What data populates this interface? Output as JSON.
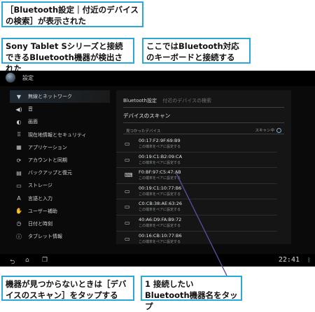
{
  "callouts": {
    "scan_screen": "［Bluetooth設定｜付近のデバイスの検索］が表示された",
    "detected": "Sony Tablet Sシリーズと接続できるBluetooth機器が検出された",
    "keyboard": "ここではBluetooth対応のキーボードと接続する",
    "not_found": "機器が見つからないときは［デバイスのスキャン］をタップする",
    "step_number": "1",
    "step_text": "接続したいBluetooth機器名をタップ"
  },
  "app": {
    "title": "設定"
  },
  "nav": [
    {
      "icon": "▼",
      "label": "無線とネットワーク"
    },
    {
      "icon": "◀)",
      "label": "音"
    },
    {
      "icon": "◐",
      "label": "画面"
    },
    {
      "icon": "⠿",
      "label": "現在地情報とセキュリティ"
    },
    {
      "icon": "▦",
      "label": "アプリケーション"
    },
    {
      "icon": "⟳",
      "label": "アカウントと同期"
    },
    {
      "icon": "▤",
      "label": "バックアップと復元"
    },
    {
      "icon": "▭",
      "label": "ストレージ"
    },
    {
      "icon": "A",
      "label": "言語と入力"
    },
    {
      "icon": "✋",
      "label": "ユーザー補助"
    },
    {
      "icon": "◷",
      "label": "日付と時刻"
    },
    {
      "icon": "ⓘ",
      "label": "タブレット情報"
    }
  ],
  "panel": {
    "breadcrumb": "Bluetooth設定",
    "breadcrumb_sub": "付近のデバイスの検索",
    "scan_button": "デバイスのスキャン",
    "found_header": "見つかったデバイス",
    "scanning": "スキャン中"
  },
  "devices": [
    {
      "icon": "▭",
      "mac": "00:17:F2:9F:69:B9",
      "sub": "この端末をペアに設定する"
    },
    {
      "icon": "▭",
      "mac": "00:19:C1:B2:09:CA",
      "sub": "この端末をペアに設定する"
    },
    {
      "icon": "⌨",
      "mac": "F0:BF:97:C5:47:AB",
      "sub": "この端末をペアに設定する"
    },
    {
      "icon": "▭",
      "mac": "00:19:C1:10:77:B6",
      "sub": "この端末をペアに設定する"
    },
    {
      "icon": "▭",
      "mac": "C0:CB:38:AE:63:26",
      "sub": "この端末をペアに設定する"
    },
    {
      "icon": "▭",
      "mac": "40:A6:D9:FA:B9:72",
      "sub": "この端末をペアに設定する"
    },
    {
      "icon": "▭",
      "mac": "00:16:CB:10:77:B6",
      "sub": "この端末をペアに設定する"
    }
  ],
  "status": {
    "clock": "22:41"
  },
  "colors": {
    "callout_border": "#2aa8d8",
    "pointer_line": "#5a4a9c"
  }
}
